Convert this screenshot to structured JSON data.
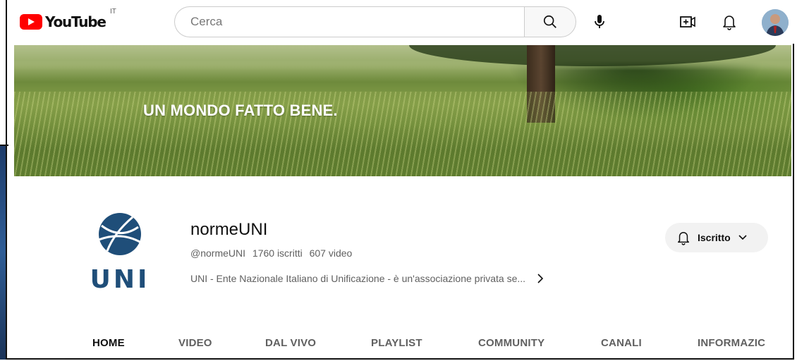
{
  "masthead": {
    "logo_text": "YouTube",
    "country_code": "IT",
    "search_placeholder": "Cerca",
    "brand_color": "#ff0000"
  },
  "banner": {
    "tagline": "UN MONDO FATTO BENE."
  },
  "channel": {
    "logo_text": "UNI",
    "name": "normeUNI",
    "handle": "@normeUNI",
    "subscribers": "1760 iscritti",
    "videos": "607 video",
    "description": "UNI - Ente Nazionale Italiano di Unificazione - è un'associazione privata se...",
    "subscribe_label": "Iscritto",
    "logo_color": "#1f4e79"
  },
  "tabs": [
    {
      "label": "HOME",
      "active": true
    },
    {
      "label": "VIDEO"
    },
    {
      "label": "DAL VIVO"
    },
    {
      "label": "PLAYLIST"
    },
    {
      "label": "COMMUNITY"
    },
    {
      "label": "CANALI"
    },
    {
      "label": "INFORMAZIC"
    }
  ],
  "icons": {
    "search": "search-icon",
    "mic": "mic-icon",
    "create": "create-video-icon",
    "notifications": "bell-icon",
    "subscribe_bell": "bell-icon",
    "more": "chevron-right-icon",
    "dropdown": "chevron-down-icon"
  }
}
